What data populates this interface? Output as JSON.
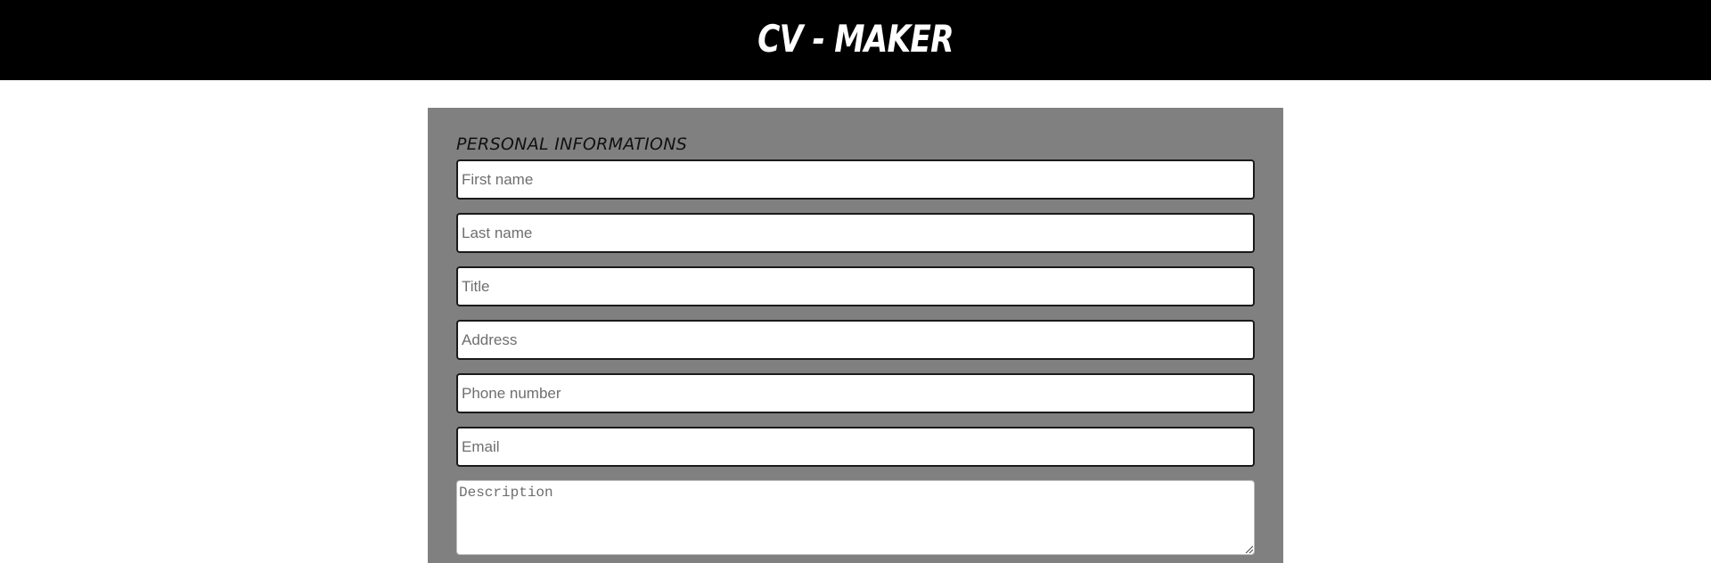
{
  "header": {
    "title": "CV - MAKER"
  },
  "personal_section": {
    "heading": "PERSONAL INFORMATIONS",
    "fields": {
      "first_name": {
        "placeholder": "First name",
        "value": ""
      },
      "last_name": {
        "placeholder": "Last name",
        "value": ""
      },
      "title": {
        "placeholder": "Title",
        "value": ""
      },
      "address": {
        "placeholder": "Address",
        "value": ""
      },
      "phone": {
        "placeholder": "Phone number",
        "value": ""
      },
      "email": {
        "placeholder": "Email",
        "value": ""
      },
      "description": {
        "placeholder": "Description",
        "value": ""
      }
    }
  },
  "icons": {
    "resize_handle": "resize-grip-icon"
  },
  "colors": {
    "header_bg": "#000000",
    "panel_bg": "#808080",
    "title_text": "#ffffff"
  }
}
